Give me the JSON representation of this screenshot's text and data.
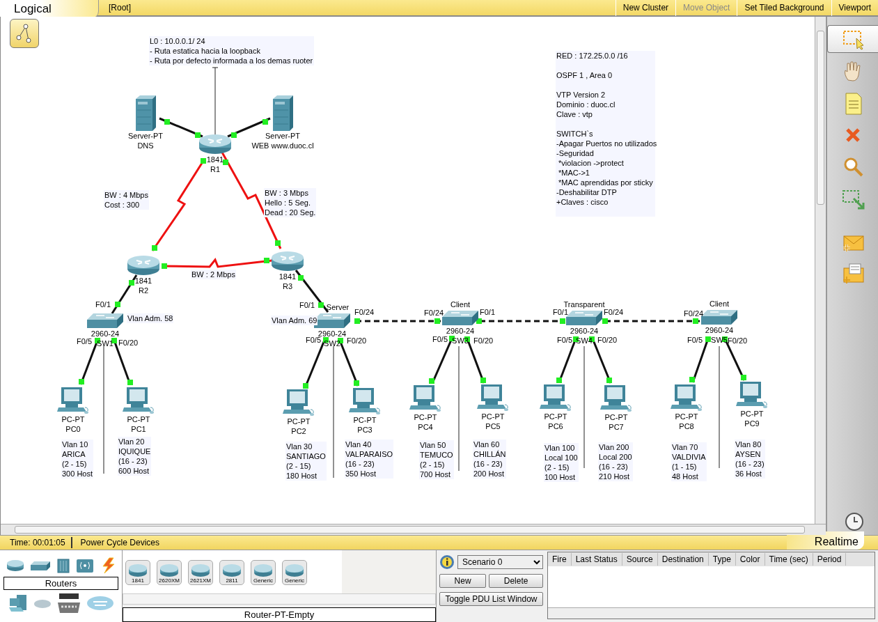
{
  "top_bar": {
    "mode": "Logical",
    "path": "[Root]",
    "menu": [
      {
        "label": "New Cluster",
        "disabled": false
      },
      {
        "label": "Move Object",
        "disabled": true
      },
      {
        "label": "Set Tiled Background",
        "disabled": false
      },
      {
        "label": "Viewport",
        "disabled": false
      }
    ]
  },
  "devices": [
    {
      "kind": "server",
      "model": "Server-PT",
      "name": "DNS"
    },
    {
      "kind": "server",
      "model": "Server-PT",
      "name": "WEB www.duoc.cl"
    },
    {
      "kind": "router",
      "model": "1841",
      "name": "R1"
    },
    {
      "kind": "router",
      "model": "1841",
      "name": "R2"
    },
    {
      "kind": "router",
      "model": "1841",
      "name": "R3"
    },
    {
      "kind": "switch",
      "model": "2960-24",
      "name": "SW1"
    },
    {
      "kind": "switch",
      "model": "2960-24",
      "name": "SW2",
      "mode": "Server"
    },
    {
      "kind": "switch",
      "model": "2960-24",
      "name": "SW3",
      "mode": "Client"
    },
    {
      "kind": "switch",
      "model": "2960-24",
      "name": "SW4",
      "mode": "Transparent"
    },
    {
      "kind": "switch",
      "model": "2960-24",
      "name": "SW5",
      "mode": "Client"
    },
    {
      "kind": "pc",
      "model": "PC-PT",
      "name": "PC0"
    },
    {
      "kind": "pc",
      "model": "PC-PT",
      "name": "PC1"
    },
    {
      "kind": "pc",
      "model": "PC-PT",
      "name": "PC2"
    },
    {
      "kind": "pc",
      "model": "PC-PT",
      "name": "PC3"
    },
    {
      "kind": "pc",
      "model": "PC-PT",
      "name": "PC4"
    },
    {
      "kind": "pc",
      "model": "PC-PT",
      "name": "PC5"
    },
    {
      "kind": "pc",
      "model": "PC-PT",
      "name": "PC6"
    },
    {
      "kind": "pc",
      "model": "PC-PT",
      "name": "PC7"
    },
    {
      "kind": "pc",
      "model": "PC-PT",
      "name": "PC8"
    },
    {
      "kind": "pc",
      "model": "PC-PT",
      "name": "PC9"
    }
  ],
  "links": [
    {
      "kind": "ethernet"
    },
    {
      "kind": "ethernet"
    },
    {
      "kind": "serial"
    },
    {
      "kind": "serial"
    },
    {
      "kind": "serial"
    },
    {
      "kind": "ethernet"
    },
    {
      "kind": "ethernet"
    },
    {
      "kind": "crossover"
    },
    {
      "kind": "crossover"
    },
    {
      "kind": "crossover"
    },
    {
      "kind": "ethernet"
    },
    {
      "kind": "ethernet"
    },
    {
      "kind": "ethernet"
    },
    {
      "kind": "ethernet"
    },
    {
      "kind": "ethernet"
    },
    {
      "kind": "ethernet"
    },
    {
      "kind": "ethernet"
    },
    {
      "kind": "ethernet"
    },
    {
      "kind": "ethernet"
    },
    {
      "kind": "ethernet"
    }
  ],
  "notes": [
    {
      "lines": [
        "L0 : 10.0.0.1/ 24",
        "- Ruta estatica hacia la loopback",
        "- Ruta por defecto informada a los demas ruoter"
      ]
    },
    {
      "lines": [
        "BW : 4 Mbps",
        "Cost : 300"
      ]
    },
    {
      "lines": [
        "BW : 3 Mbps",
        "Hello : 5 Seg.",
        "Dead : 20 Seg."
      ]
    },
    {
      "lines": [
        "BW : 2 Mbps"
      ]
    },
    {
      "lines": [
        "Vlan Adm. 58"
      ]
    },
    {
      "lines": [
        "Vlan Adm. 69"
      ]
    },
    {
      "lines": [
        "Vlan 10",
        "ARICA",
        "(2 - 15)",
        "300 Host"
      ]
    },
    {
      "lines": [
        "Vlan 20",
        "IQUIQUE",
        "(16 - 23)",
        "600 Host"
      ]
    },
    {
      "lines": [
        "Vlan 30",
        "SANTIAGO",
        "(2 - 15)",
        "180 Host"
      ]
    },
    {
      "lines": [
        "Vlan 40",
        "VALPARAISO",
        "(16 - 23)",
        "350 Host"
      ]
    },
    {
      "lines": [
        "Vlan 50",
        "TEMUCO",
        "(2 - 15)",
        "700 Host"
      ]
    },
    {
      "lines": [
        "Vlan 60",
        "CHILLÁN",
        "(16 - 23)",
        "200 Host"
      ]
    },
    {
      "lines": [
        "Vlan 100",
        "Local 100",
        "(2 - 15)",
        "100 Host"
      ]
    },
    {
      "lines": [
        "Vlan 200",
        "Local 200",
        "(16 - 23)",
        "210 Host"
      ]
    },
    {
      "lines": [
        "Vlan 70",
        "VALDIVIA",
        "(1 - 15)",
        "48 Host"
      ]
    },
    {
      "lines": [
        "Vlan 80",
        "AYSEN",
        "(16 - 23)",
        "36 Host"
      ]
    }
  ],
  "config_note": {
    "paragraphs": [
      [
        "RED : 172.25.0.0 /16"
      ],
      [
        "OSPF 1 , Area 0"
      ],
      [
        "VTP Version 2",
        "Dominio : duoc.cl",
        "Clave : vtp"
      ],
      [
        "SWITCH`s",
        "-Apagar Puertos no utilizados",
        "-Seguridad",
        " *violacion ->protect",
        " *MAC->1",
        " *MAC aprendidas por sticky",
        "-Deshabilitar DTP",
        "+Claves : cisco"
      ]
    ]
  },
  "port_labels": [
    "F0/1",
    "F0/5",
    "F0/20",
    "F0/1",
    "F0/24",
    "F0/5",
    "F0/20",
    "F0/24",
    "F0/1",
    "F0/5",
    "F0/20",
    "F0/1",
    "F0/24",
    "F0/5",
    "F0/20",
    "F0/24",
    "F0/5",
    "F0/20"
  ],
  "tools": [
    {
      "kind": "select",
      "selected": true
    },
    {
      "kind": "move",
      "selected": false
    },
    {
      "kind": "note",
      "selected": false
    },
    {
      "kind": "delete",
      "selected": false
    },
    {
      "kind": "inspect",
      "selected": false
    },
    {
      "kind": "resize",
      "selected": false
    },
    {
      "kind": "simple-pdu",
      "selected": false
    },
    {
      "kind": "complex-pdu",
      "selected": false
    }
  ],
  "status_bar": {
    "time": "Time: 00:01:05",
    "power_cycle": "Power Cycle Devices",
    "mode": "Realtime"
  },
  "device_panel": {
    "category": "Routers",
    "models": [
      "1841",
      "2620XM",
      "2621XM",
      "2811",
      "Generic",
      "Generic"
    ],
    "selected_model": "Router-PT-Empty"
  },
  "scenario": {
    "value": "Scenario 0",
    "buttons": [
      "New",
      "Delete"
    ],
    "toggle": "Toggle PDU List Window"
  },
  "pdu_table": {
    "columns": [
      "Fire",
      "Last Status",
      "Source",
      "Destination",
      "Type",
      "Color",
      "Time (sec)",
      "Period"
    ]
  }
}
